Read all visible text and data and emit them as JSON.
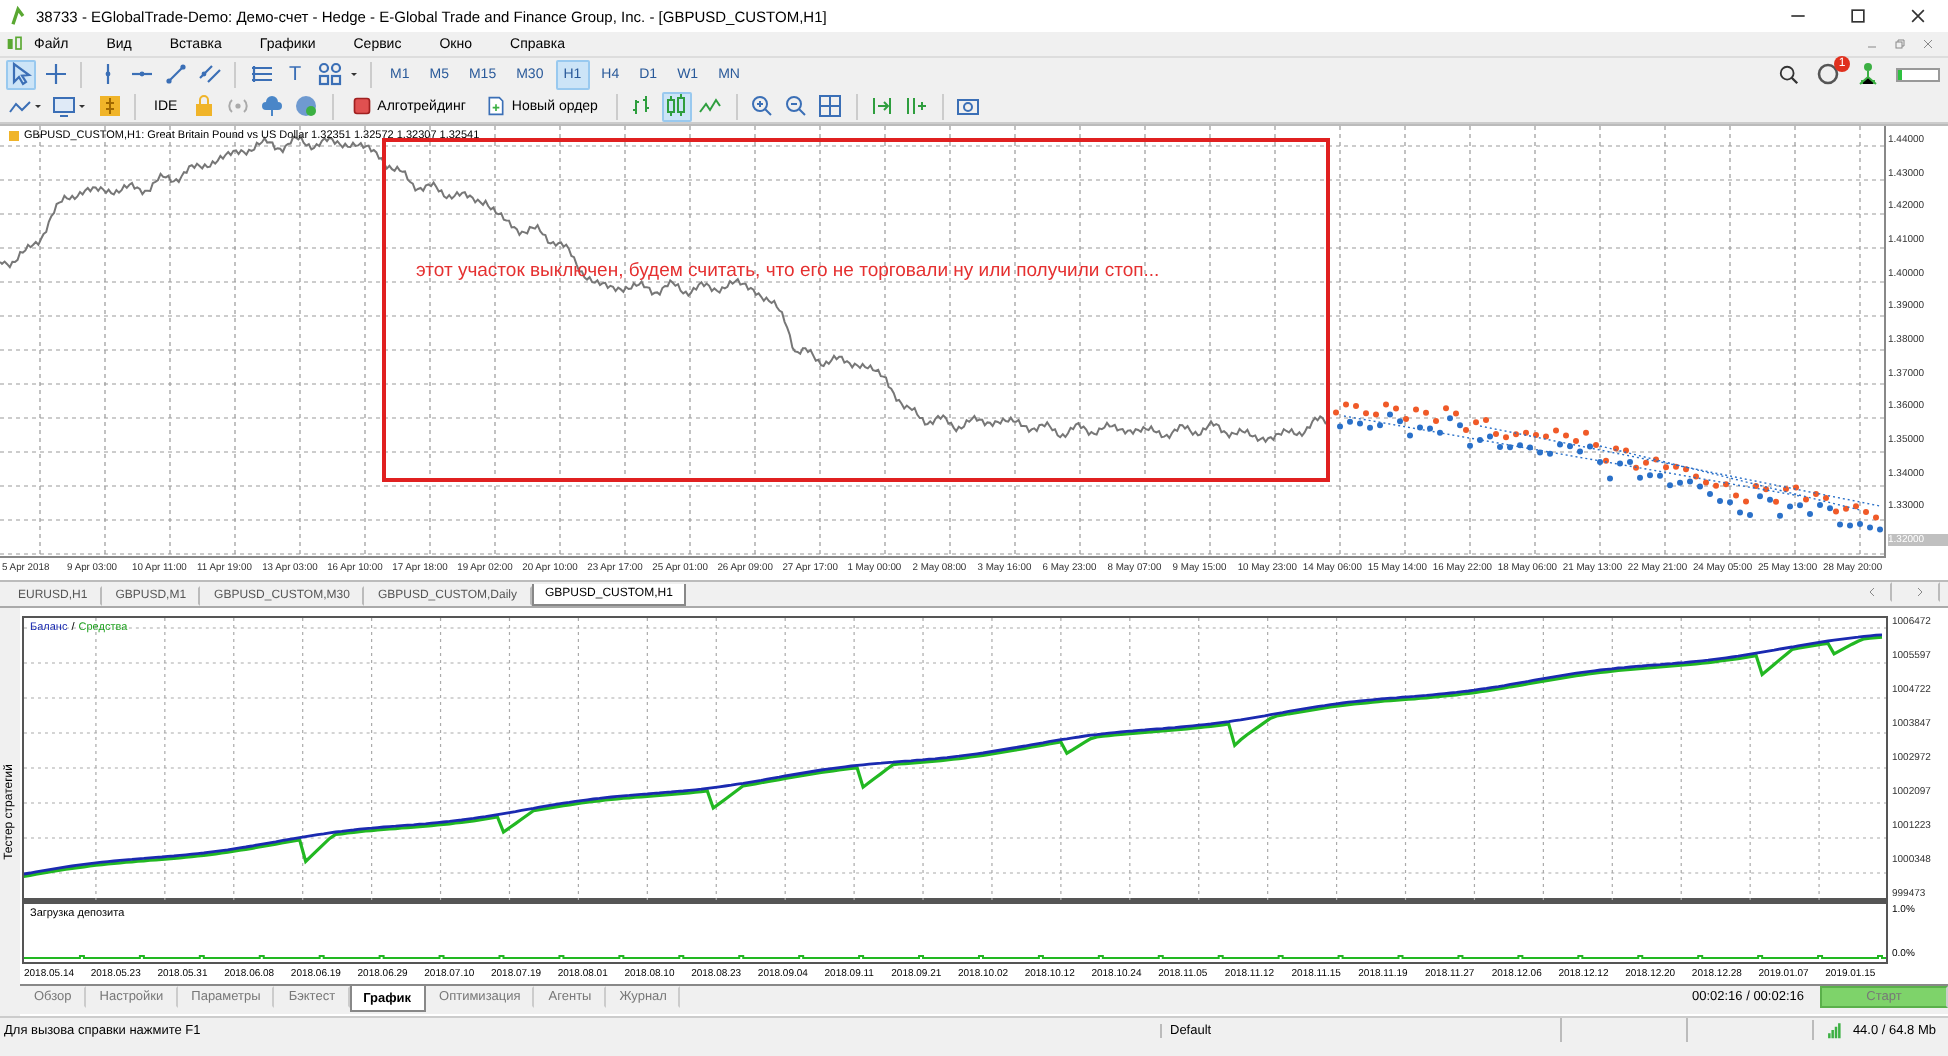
{
  "window": {
    "title": "38733 - EGlobalTrade-Demo: Демо-счет - Hedge - E-Global Trade and Finance Group, Inc. - [GBPUSD_CUSTOM,H1]"
  },
  "menu": [
    "Файл",
    "Вид",
    "Вставка",
    "Графики",
    "Сервис",
    "Окно",
    "Справка"
  ],
  "toolbar": {
    "tools": [
      {
        "selected": true
      },
      {
        "selected": false
      },
      {
        "selected": false
      },
      {
        "selected": false
      },
      {
        "selected": false
      },
      {
        "selected": false
      },
      {
        "selected": false
      },
      {
        "label": "T",
        "selected": false
      },
      {
        "selected": false
      }
    ],
    "timeframes": [
      {
        "label": "M1",
        "selected": false
      },
      {
        "label": "M5",
        "selected": false
      },
      {
        "label": "M15",
        "selected": false
      },
      {
        "label": "M30",
        "selected": false
      },
      {
        "label": "H1",
        "selected": true
      },
      {
        "label": "H4",
        "selected": false
      },
      {
        "label": "D1",
        "selected": false
      },
      {
        "label": "W1",
        "selected": false
      },
      {
        "label": "MN",
        "selected": false
      }
    ],
    "notifications_badge": "1",
    "network_meter": {
      "level": 0.12
    },
    "ide": "IDE",
    "algo_trading": "Алготрейдинг",
    "new_order": "Новый ордер",
    "chart_types": [
      {
        "selected": false
      },
      {
        "selected": true
      },
      {
        "selected": false
      }
    ]
  },
  "chart": {
    "header": "GBPUSD_CUSTOM,H1:  Great Britain Pound vs US Dollar  1.32351 1.32572 1.32307 1.32541",
    "annotation": "этот участок выключен, будем считать, что его не торговали ну или получили стоп...",
    "price_labels": [
      "1.44000",
      "1.43000",
      "1.42000",
      "1.41000",
      "1.40000",
      "1.39000",
      "1.38000",
      "1.37000",
      "1.36000",
      "1.35000",
      "1.34000",
      "1.33000",
      "1.32000"
    ],
    "time_labels": [
      "5 Apr 2018",
      "9 Apr 03:00",
      "10 Apr 11:00",
      "11 Apr 19:00",
      "13 Apr 03:00",
      "16 Apr 10:00",
      "17 Apr 18:00",
      "19 Apr 02:00",
      "20 Apr 10:00",
      "23 Apr 17:00",
      "25 Apr 01:00",
      "26 Apr 09:00",
      "27 Apr 17:00",
      "1 May 00:00",
      "2 May 08:00",
      "3 May 16:00",
      "6 May 23:00",
      "8 May 07:00",
      "9 May 15:00",
      "10 May 23:00",
      "14 May 06:00",
      "15 May 14:00",
      "16 May 22:00",
      "18 May 06:00",
      "21 May 13:00",
      "22 May 21:00",
      "24 May 05:00",
      "25 May 13:00",
      "28 May 20:00"
    ]
  },
  "chart_tabs": [
    {
      "label": "EURUSD,H1",
      "selected": false
    },
    {
      "label": "GBPUSD,M1",
      "selected": false
    },
    {
      "label": "GBPUSD_CUSTOM,M30",
      "selected": false
    },
    {
      "label": "GBPUSD_CUSTOM,Daily",
      "selected": false
    },
    {
      "label": "GBPUSD_CUSTOM,H1",
      "selected": true
    }
  ],
  "tester": {
    "title": "Тестер стратегий",
    "legend": {
      "balance": "Баланс",
      "separator": "/",
      "equity": "Средства"
    },
    "balance_labels": [
      "1006472",
      "1005597",
      "1004722",
      "1003847",
      "1002972",
      "1002097",
      "1001223",
      "1000348",
      "999473"
    ],
    "load_title": "Загрузка депозита",
    "load_labels": [
      "1.0%",
      "0.0%"
    ],
    "dates": [
      "2018.05.14",
      "2018.05.23",
      "2018.05.31",
      "2018.06.08",
      "2018.06.19",
      "2018.06.29",
      "2018.07.10",
      "2018.07.19",
      "2018.08.01",
      "2018.08.10",
      "2018.08.23",
      "2018.09.04",
      "2018.09.11",
      "2018.09.21",
      "2018.10.02",
      "2018.10.12",
      "2018.10.24",
      "2018.11.05",
      "2018.11.12",
      "2018.11.15",
      "2018.11.19",
      "2018.11.27",
      "2018.12.06",
      "2018.12.12",
      "2018.12.20",
      "2018.12.28",
      "2019.01.07",
      "2019.01.15"
    ],
    "tabs": [
      {
        "label": "Обзор",
        "selected": false
      },
      {
        "label": "Настройки",
        "selected": false
      },
      {
        "label": "Параметры",
        "selected": false
      },
      {
        "label": "Бэктест",
        "selected": false
      },
      {
        "label": "График",
        "selected": true
      },
      {
        "label": "Оптимизация",
        "selected": false
      },
      {
        "label": "Агенты",
        "selected": false
      },
      {
        "label": "Журнал",
        "selected": false
      }
    ],
    "elapsed": "00:02:16 / 00:02:16",
    "start": "Старт"
  },
  "status_bar": {
    "help": "Для вызова справки нажмите F1",
    "profile": "Default",
    "memory": "44.0 / 64.8 Mb"
  }
}
